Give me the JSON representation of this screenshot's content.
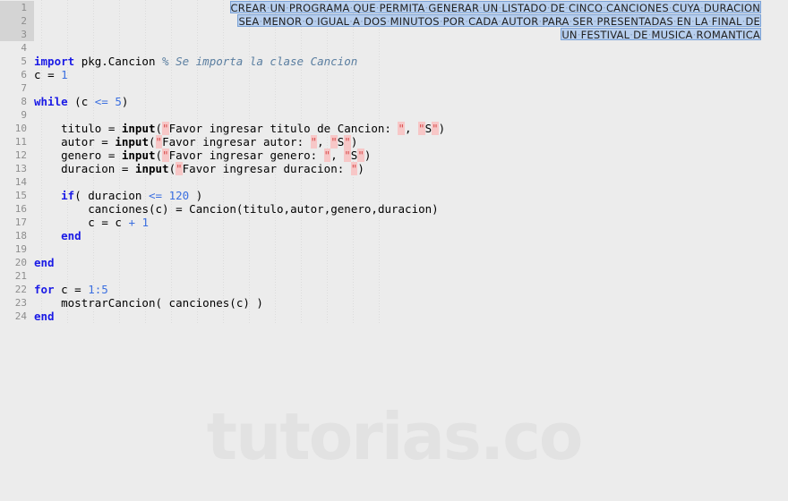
{
  "watermark": {
    "text": "tutorias.co"
  },
  "editor": {
    "language": "MATLAB/Octave",
    "colors": {
      "background": "#ececec",
      "keyword": "#1a1ae6",
      "number": "#3b6fe0",
      "comment": "#5a7ea0",
      "string_quote": "#d94f4f",
      "string_quote_bg": "#f7c7c7",
      "selection_bg": "#b8cfee",
      "selection_border": "#7ba2d6",
      "gutter_number": "#8d8d8d",
      "gutter_selected_band": "#d4d4d4",
      "indent_guide": "#dcdcdc"
    },
    "gutter": {
      "line_numbers": [
        1,
        2,
        3,
        4,
        5,
        6,
        7,
        8,
        9,
        10,
        11,
        12,
        13,
        14,
        15,
        16,
        17,
        18,
        19,
        20,
        21,
        22,
        23,
        24
      ],
      "selected_lines": [
        1,
        2,
        3
      ]
    },
    "selection_block": {
      "line1": "CREAR UN PROGRAMA QUE PERMITA GENERAR UN LISTADO DE CINCO CANCIONES CUYA DURACION",
      "line2": "SEA MENOR O IGUAL A DOS MINUTOS POR CADA AUTOR PARA SER PRESENTADAS EN LA FINAL DE",
      "line3": "UN FESTIVAL DE MUSICA ROMANTICA"
    },
    "code_lines": [
      {
        "n": 1,
        "kind": "selection",
        "indent": 0,
        "text": "CREAR UN PROGRAMA QUE PERMITA GENERAR UN LISTADO DE CINCO CANCIONES CUYA DURACION"
      },
      {
        "n": 2,
        "kind": "selection",
        "indent": 0,
        "text": "SEA MENOR O IGUAL A DOS MINUTOS POR CADA AUTOR PARA SER PRESENTADAS EN LA FINAL DE"
      },
      {
        "n": 3,
        "kind": "selection",
        "indent": 0,
        "text": "UN FESTIVAL DE MUSICA ROMANTICA"
      },
      {
        "n": 4,
        "kind": "blank",
        "text": ""
      },
      {
        "n": 5,
        "kind": "code",
        "text": "import pkg.Cancion % Se importa la clase Cancion"
      },
      {
        "n": 6,
        "kind": "code",
        "text": "c = 1"
      },
      {
        "n": 7,
        "kind": "blank",
        "text": ""
      },
      {
        "n": 8,
        "kind": "code",
        "text": "while (c <= 5)"
      },
      {
        "n": 9,
        "kind": "blank",
        "text": ""
      },
      {
        "n": 10,
        "kind": "code",
        "text": "    titulo = input(\"Favor ingresar titulo de Cancion: \", \"S\")"
      },
      {
        "n": 11,
        "kind": "code",
        "text": "    autor = input(\"Favor ingresar autor: \", \"S\")"
      },
      {
        "n": 12,
        "kind": "code",
        "text": "    genero = input(\"Favor ingresar genero: \", \"S\")"
      },
      {
        "n": 13,
        "kind": "code",
        "text": "    duracion = input(\"Favor ingresar duracion: \")"
      },
      {
        "n": 14,
        "kind": "blank",
        "text": ""
      },
      {
        "n": 15,
        "kind": "code",
        "text": "    if( duracion <= 120 )"
      },
      {
        "n": 16,
        "kind": "code",
        "text": "        canciones(c) = Cancion(titulo,autor,genero,duracion)"
      },
      {
        "n": 17,
        "kind": "code",
        "text": "        c = c + 1"
      },
      {
        "n": 18,
        "kind": "code",
        "text": "    end"
      },
      {
        "n": 19,
        "kind": "blank",
        "text": ""
      },
      {
        "n": 20,
        "kind": "code",
        "text": "end"
      },
      {
        "n": 21,
        "kind": "blank",
        "text": ""
      },
      {
        "n": 22,
        "kind": "code",
        "text": "for c = 1:5"
      },
      {
        "n": 23,
        "kind": "code",
        "text": "    mostrarCancion( canciones(c) )"
      },
      {
        "n": 24,
        "kind": "code",
        "text": "end"
      }
    ]
  }
}
